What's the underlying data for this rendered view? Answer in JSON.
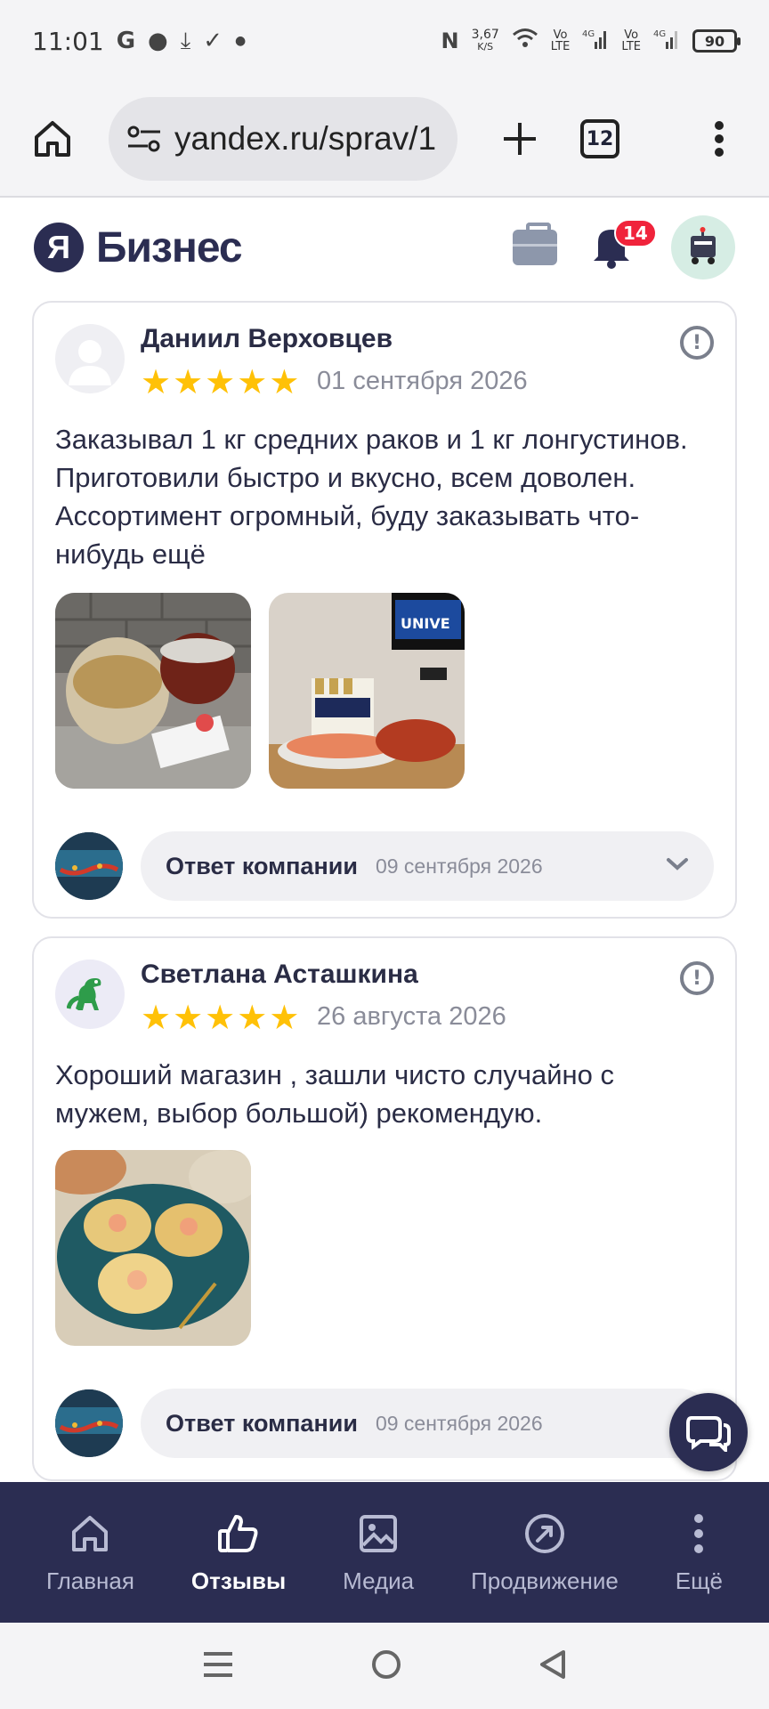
{
  "status_bar": {
    "time": "11:01",
    "net_speed_value": "3,67",
    "net_speed_unit": "K/S",
    "battery": "90"
  },
  "browser": {
    "url": "yandex.ru/sprav/1",
    "tab_count": "12"
  },
  "header": {
    "logo_letter": "Я",
    "logo_text": "Бизнес",
    "notification_count": "14"
  },
  "reviews": [
    {
      "author": "Даниил Верховцев",
      "rating": 5,
      "date": "01 сентября 2026",
      "text": "Заказывал 1 кг средних раков и 1 кг лонгустинов. Приготовили быстро и вкусно, всем доволен. Ассортимент огромный, буду заказывать что-нибудь ещё",
      "reply_label": "Ответ компании",
      "reply_date": "09 сентября 2026"
    },
    {
      "author": "Светлана Асташкина",
      "rating": 5,
      "date": "26 августа 2026",
      "text": "Хороший магазин , зашли чисто случайно с мужем, выбор большой) рекомендую.",
      "reply_label": "Ответ компании",
      "reply_date": "09 сентября 2026"
    }
  ],
  "bottom_nav": [
    {
      "label": "Главная",
      "icon": "home-icon",
      "active": false
    },
    {
      "label": "Отзывы",
      "icon": "thumbs-up-icon",
      "active": true
    },
    {
      "label": "Медиа",
      "icon": "image-icon",
      "active": false
    },
    {
      "label": "Продвижение",
      "icon": "compass-icon",
      "active": false
    },
    {
      "label": "Ещё",
      "icon": "more-vertical-icon",
      "active": false
    }
  ],
  "colors": {
    "brand": "#2b2d52",
    "star": "#ffc107",
    "badge": "#f0233b"
  }
}
